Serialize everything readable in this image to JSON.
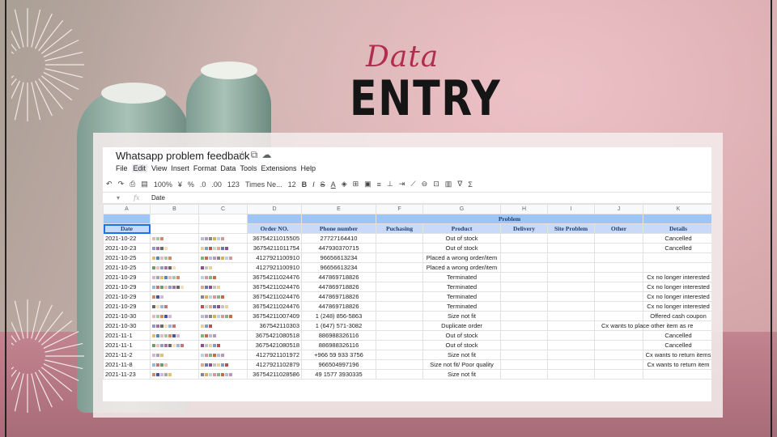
{
  "slide": {
    "title_script": "Data",
    "title_main": "ENTRY"
  },
  "doc": {
    "title": "Whatsapp problem feedback"
  },
  "menu": [
    "File",
    "Edit",
    "View",
    "Insert",
    "Format",
    "Data",
    "Tools",
    "Extensions",
    "Help"
  ],
  "toolbar": {
    "zoom": "100%",
    "currency": "¥",
    "percent": "%",
    "dec_less": ".0",
    "dec_more": ".00",
    "num_format": "123",
    "font": "Times Ne...",
    "font_size": "12",
    "bold": "B",
    "italic": "I",
    "strike": "S",
    "text_color": "A"
  },
  "formula_bar": {
    "fx": "fx",
    "value": "Date"
  },
  "columns": [
    "A",
    "B",
    "C",
    "D",
    "E",
    "F",
    "G",
    "H",
    "I",
    "J",
    "K"
  ],
  "band_label": "Problem",
  "headers": [
    "Date",
    "",
    "",
    "Order NO.",
    "Phone number",
    "Puchasing",
    "Product",
    "Delivery",
    "Site Problem",
    "Other",
    "Details"
  ],
  "rows": [
    [
      "2021-10-22",
      "36754211015505",
      "27727164410",
      "Out of stock",
      "Cancelled"
    ],
    [
      "2021-10-23",
      "36754211011754",
      "447930370715",
      "Out of stock",
      "Cancelled"
    ],
    [
      "2021-10-25",
      "4127921100910",
      "96656613234",
      "Placed a wrong order/item",
      ""
    ],
    [
      "2021-10-25",
      "4127921100910",
      "96656613234",
      "Placed a wrong order/item",
      ""
    ],
    [
      "2021-10-29",
      "36754211024476",
      "447869718826",
      "Terminated",
      "Cx no longer interested"
    ],
    [
      "2021-10-29",
      "36754211024476",
      "447869718826",
      "Terminated",
      "Cx no longer interested"
    ],
    [
      "2021-10-29",
      "36754211024476",
      "447869718826",
      "Terminated",
      "Cx no longer interested"
    ],
    [
      "2021-10-29",
      "36754211024476",
      "447869718826",
      "Terminated",
      "Cx no longer interested"
    ],
    [
      "2021-10-30",
      "36754211007409",
      "1 (248) 856-5863",
      "Size not fit",
      "Offered cash coupon"
    ],
    [
      "2021-10-30",
      "367542110303",
      "1 (647) 571-3082",
      "Duplicate order",
      "Cx wants to place other item as re"
    ],
    [
      "2021-11-1",
      "3675421080518",
      "886988326116",
      "Out of stock",
      "Cancelled"
    ],
    [
      "2021-11-1",
      "3675421080518",
      "886988326116",
      "Out of stock",
      "Cancelled"
    ],
    [
      "2021-11-2",
      "4127921101972",
      "+966 59 933 3756",
      "Size not fit",
      "Cx wants to return items"
    ],
    [
      "2021-11-8",
      "4127921102879",
      "966504997196",
      "Size not fit/ Poor quality",
      "Cx wants to return item"
    ],
    [
      "2021-11-23",
      "36754211028586",
      "49 1577 3930335",
      "Size not fit",
      ""
    ]
  ],
  "colors": {
    "band": "#9fc5f8",
    "header": "#c9daf8",
    "accent": "#b12d4e"
  }
}
